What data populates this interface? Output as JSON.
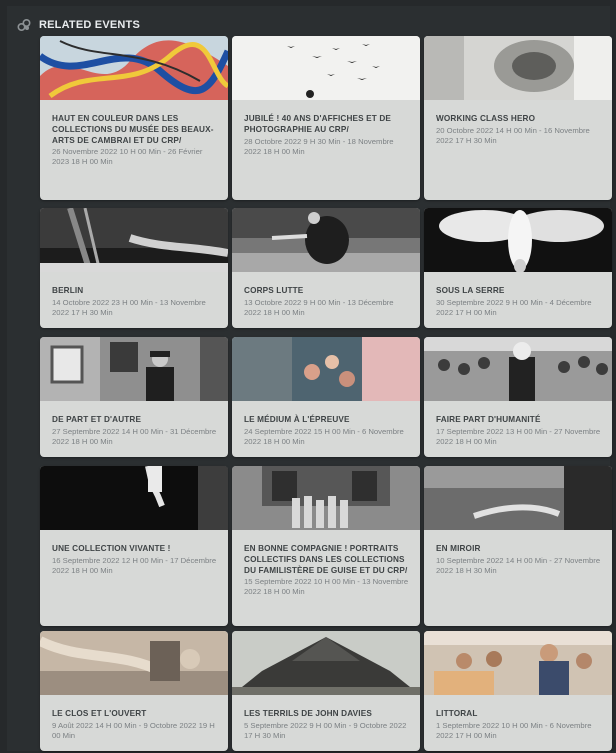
{
  "section": {
    "title": "RELATED EVENTS",
    "icon": "link-icon"
  },
  "events": [
    {
      "title": "HAUT EN COULEUR DANS LES COLLECTIONS DU MUSÉE DES BEAUX-ARTS DE CAMBRAI ET DU CRP/",
      "date": "26 Novembre 2022 10 H 00 Min - 26 Février 2023 18 H 00 Min"
    },
    {
      "title": "JUBILÉ ! 40 ANS D'AFFICHES ET DE PHOTOGRAPHIE AU CRP/",
      "date": "28 Octobre 2022 9 H 30 Min - 18 Novembre 2022 18 H 00 Min"
    },
    {
      "title": "WORKING CLASS HERO",
      "date": "20 Octobre 2022 14 H 00 Min - 16 Novembre 2022 17 H 30 Min"
    },
    {
      "title": "BERLIN",
      "date": "14 Octobre 2022 23 H 00 Min - 13 Novembre 2022 17 H 30 Min"
    },
    {
      "title": "CORPS LUTTE",
      "date": "13 Octobre 2022 9 H 00 Min - 13 Décembre 2022 18 H 00 Min"
    },
    {
      "title": "SOUS LA SERRE",
      "date": "30 Septembre 2022 9 H 00 Min - 4 Décembre 2022 17 H 00 Min"
    },
    {
      "title": "DE PART ET D'AUTRE",
      "date": "27 Septembre 2022 14 H 00 Min - 31 Décembre 2022 18 H 00 Min"
    },
    {
      "title": "LE MÉDIUM À L'ÉPREUVE",
      "date": "24 Septembre 2022 15 H 00 Min - 6 Novembre 2022 18 H 00 Min"
    },
    {
      "title": "FAIRE PART D'HUMANITÉ",
      "date": "17 Septembre 2022 13 H 00 Min - 27 Novembre 2022 18 H 00 Min"
    },
    {
      "title": "UNE COLLECTION VIVANTE !",
      "date": "16 Septembre 2022 12 H 00 Min - 17 Décembre 2022 18 H 00 Min"
    },
    {
      "title": "EN BONNE COMPAGNIE ! PORTRAITS COLLECTIFS DANS LES COLLECTIONS DU FAMILISTÈRE DE GUISE ET DU CRP/",
      "date": "15 Septembre 2022 10 H 00 Min - 13 Novembre 2022 18 H 00 Min"
    },
    {
      "title": "EN MIROIR",
      "date": "10 Septembre 2022 14 H 00 Min - 27 Novembre 2022 18 H 30 Min"
    },
    {
      "title": "LE CLOS ET L'OUVERT",
      "date": "9 Août 2022 14 H 00 Min - 9 Octobre 2022 19 H 00 Min"
    },
    {
      "title": "LES TERRILS DE JOHN DAVIES",
      "date": "5 Septembre 2022 9 H 00 Min - 9 Octobre 2022 17 H 30 Min"
    },
    {
      "title": "LITTORAL",
      "date": "1 Septembre 2022 10 H 00 Min - 6 Novembre 2022 17 H 00 Min"
    }
  ]
}
